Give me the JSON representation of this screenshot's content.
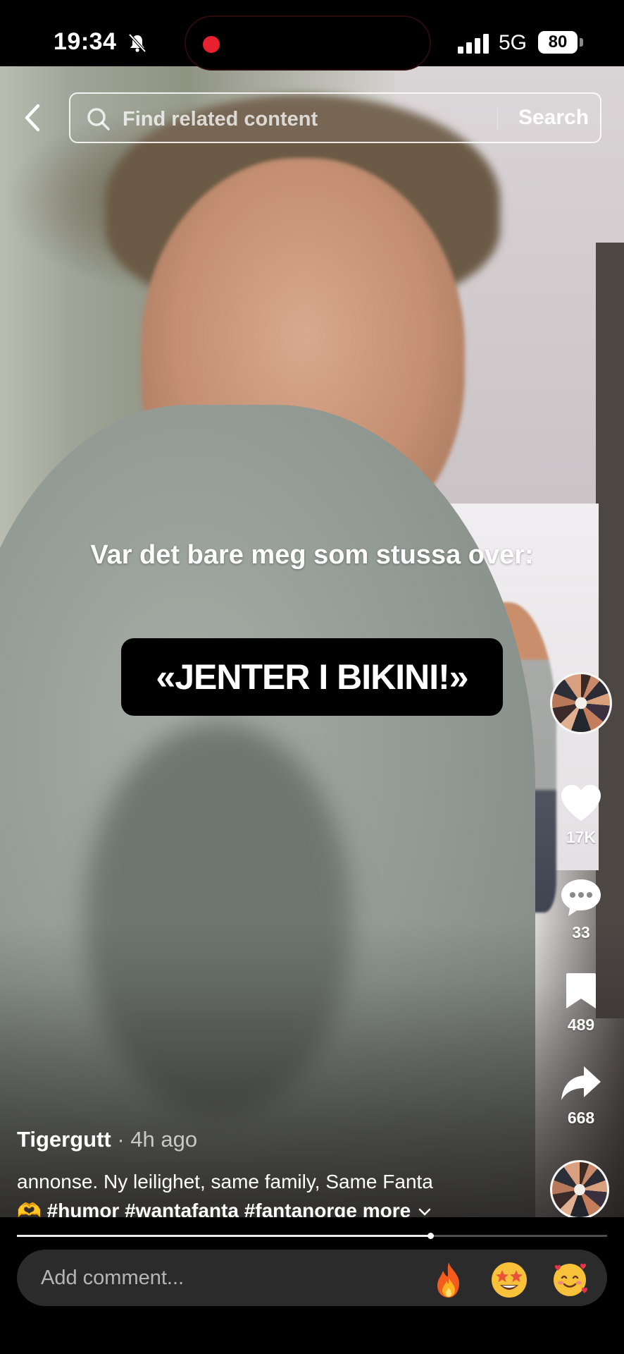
{
  "status_bar": {
    "time": "19:34",
    "network": "5G",
    "battery": "80"
  },
  "search": {
    "placeholder": "Find related content",
    "button_label": "Search"
  },
  "video": {
    "caption_top": "Var det bare meg som stussa over:",
    "caption_box": "«JENTER I BIKINI!»"
  },
  "actions": {
    "likes": "17K",
    "comments": "33",
    "saves": "489",
    "shares": "668"
  },
  "post": {
    "author": "Tigergutt",
    "time_ago": " · 4h ago",
    "description_line1": "annonse. Ny leilighet, same family, Same Fanta",
    "emoji_lead": "🫶",
    "hashtags": " #humor #wantafanta #fantanorge ",
    "more_label": "more"
  },
  "playback": {
    "progress": 0.7
  },
  "comment": {
    "placeholder": "Add comment..."
  },
  "icons": {
    "back": "back-icon",
    "search": "search-icon",
    "like": "heart-icon",
    "comment": "comment-bubble-icon",
    "save": "bookmark-icon",
    "share": "share-icon",
    "emoji_1": "fire-emoji",
    "emoji_2": "star-struck-emoji",
    "emoji_3": "smiling-face-with-hearts-emoji"
  },
  "colors": {
    "record_dot": "#e8212e",
    "caption_box_bg": "#000000",
    "comment_bar_bg": "#2b2b2b"
  }
}
